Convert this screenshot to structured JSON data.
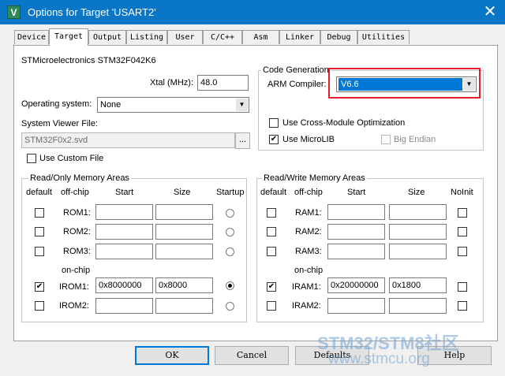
{
  "window": {
    "title": "Options for Target 'USART2'",
    "app_icon": "V",
    "close": "✕"
  },
  "tabs": [
    "Device",
    "Target",
    "Output",
    "Listing",
    "User",
    "C/C++",
    "Asm",
    "Linker",
    "Debug",
    "Utilities"
  ],
  "device_name": "STMicroelectronics STM32F042K6",
  "xtal": {
    "label": "Xtal (MHz):",
    "value": "48.0"
  },
  "operating_system": {
    "label": "Operating system:",
    "value": "None"
  },
  "system_viewer": {
    "label": "System Viewer File:",
    "value": "STM32F0x2.svd",
    "browse": "..."
  },
  "use_custom_file": {
    "label": "Use Custom File",
    "checked": false
  },
  "code_generation": {
    "title": "Code Generation",
    "arm_compiler_label": "ARM Compiler:",
    "arm_compiler_value": "V6.6",
    "cross_module": {
      "label": "Use Cross-Module Optimization",
      "checked": false
    },
    "microlib": {
      "label": "Use MicroLIB",
      "checked": true
    },
    "big_endian": {
      "label": "Big Endian",
      "checked": false
    }
  },
  "ro_memory": {
    "title": "Read/Only Memory Areas",
    "headers": {
      "default": "default",
      "offchip": "off-chip",
      "start": "Start",
      "size": "Size",
      "startup": "Startup"
    },
    "onchip_label": "on-chip",
    "rows": [
      {
        "name": "ROM1:",
        "default": false,
        "start": "",
        "size": "",
        "startup": false
      },
      {
        "name": "ROM2:",
        "default": false,
        "start": "",
        "size": "",
        "startup": false
      },
      {
        "name": "ROM3:",
        "default": false,
        "start": "",
        "size": "",
        "startup": false
      },
      {
        "name": "IROM1:",
        "default": true,
        "start": "0x8000000",
        "size": "0x8000",
        "startup": true
      },
      {
        "name": "IROM2:",
        "default": false,
        "start": "",
        "size": "",
        "startup": false
      }
    ]
  },
  "rw_memory": {
    "title": "Read/Write Memory Areas",
    "headers": {
      "default": "default",
      "offchip": "off-chip",
      "start": "Start",
      "size": "Size",
      "noinit": "NoInit"
    },
    "onchip_label": "on-chip",
    "rows": [
      {
        "name": "RAM1:",
        "default": false,
        "start": "",
        "size": "",
        "noinit": false
      },
      {
        "name": "RAM2:",
        "default": false,
        "start": "",
        "size": "",
        "noinit": false
      },
      {
        "name": "RAM3:",
        "default": false,
        "start": "",
        "size": "",
        "noinit": false
      },
      {
        "name": "IRAM1:",
        "default": true,
        "start": "0x20000000",
        "size": "0x1800",
        "noinit": false
      },
      {
        "name": "IRAM2:",
        "default": false,
        "start": "",
        "size": "",
        "noinit": false
      }
    ]
  },
  "buttons": {
    "ok": "OK",
    "cancel": "Cancel",
    "defaults": "Defaults",
    "help": "Help"
  },
  "watermark": {
    "line1": "STM32/STM8社区",
    "line2": "www.stmcu.org"
  },
  "colors": {
    "titlebar": "#0a76c8",
    "selection": "#0078d7",
    "highlight_box": "#e0202a"
  }
}
